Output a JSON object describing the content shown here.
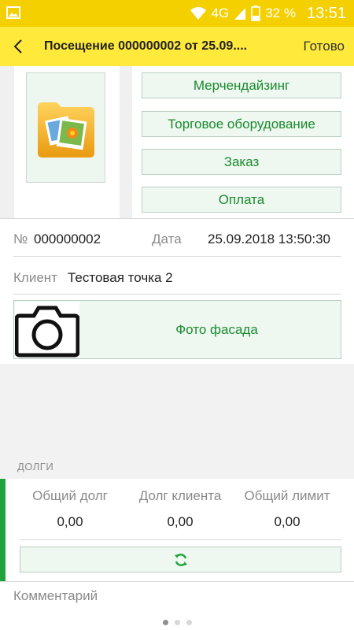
{
  "status_bar": {
    "network": "4G",
    "battery": "32 %",
    "time": "13:51"
  },
  "header": {
    "title": "Посещение 000000002 от 25.09....",
    "done_label": "Готово"
  },
  "menu": {
    "items": [
      {
        "label": "Мерчендайзинг"
      },
      {
        "label": "Торговое оборудование"
      },
      {
        "label": "Заказ"
      },
      {
        "label": "Оплата"
      }
    ]
  },
  "visit": {
    "number_label": "№",
    "number": "000000002",
    "date_label": "Дата",
    "date": "25.09.2018 13:50:30",
    "client_label": "Клиент",
    "client": "Тестовая точка 2",
    "photo_label": "Фото фасада"
  },
  "debts": {
    "section_title": "ДОЛГИ",
    "columns": [
      {
        "header": "Общий долг",
        "value": "0,00"
      },
      {
        "header": "Долг клиента",
        "value": "0,00"
      },
      {
        "header": "Общий лимит",
        "value": "0,00"
      }
    ]
  },
  "comment": {
    "placeholder": "Комментарий"
  },
  "colors": {
    "header_yellow": "#ffe93a",
    "status_yellow": "#f5d000",
    "accent_green": "#1fa33a",
    "button_text_green": "#1b8a2d"
  },
  "pager": {
    "count": 3,
    "active": 0
  }
}
